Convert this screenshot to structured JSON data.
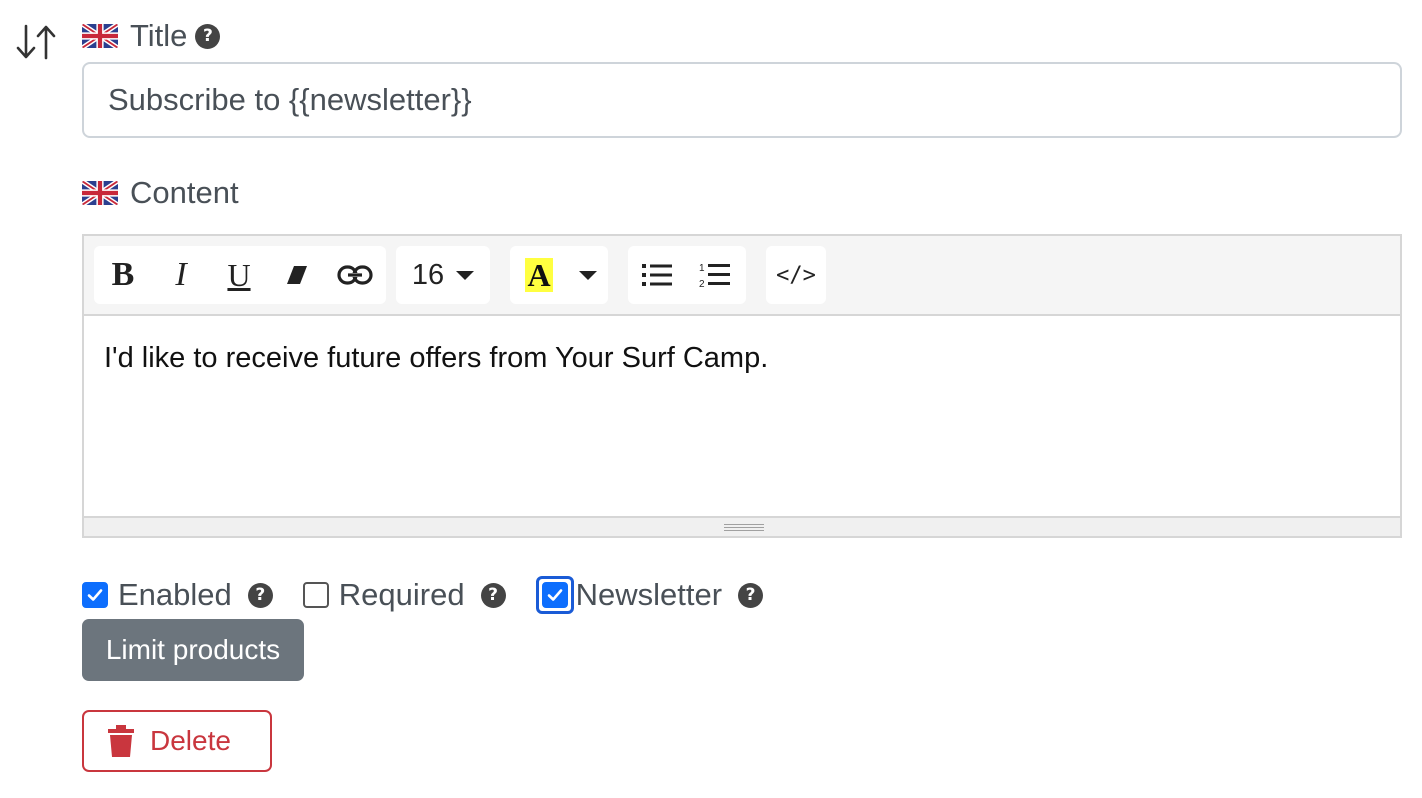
{
  "title_field": {
    "label": "Title",
    "value": "Subscribe to {{newsletter}}",
    "help": "?"
  },
  "content_field": {
    "label": "Content",
    "font_size": "16",
    "body": "I'd like to receive future offers from Your Surf Camp."
  },
  "toolbar": {
    "buttons": [
      "bold-icon",
      "italic-icon",
      "underline-icon",
      "eraser-icon",
      "link-icon",
      "text-color-icon",
      "unordered-list-icon",
      "ordered-list-icon",
      "code-view-icon"
    ],
    "highlight_color": "#ffff40",
    "code_label": "</>",
    "bold_label": "B",
    "italic_label": "I",
    "underline_label": "U",
    "color_label": "A"
  },
  "options": {
    "enabled": {
      "label": "Enabled",
      "checked": true
    },
    "required": {
      "label": "Required",
      "checked": false
    },
    "newsletter": {
      "label": "Newsletter",
      "checked": true
    }
  },
  "actions": {
    "limit_products": "Limit products",
    "delete": "Delete"
  },
  "colors": {
    "primary": "#0d6efd",
    "secondary": "#6c757d",
    "danger": "#c9363e"
  }
}
